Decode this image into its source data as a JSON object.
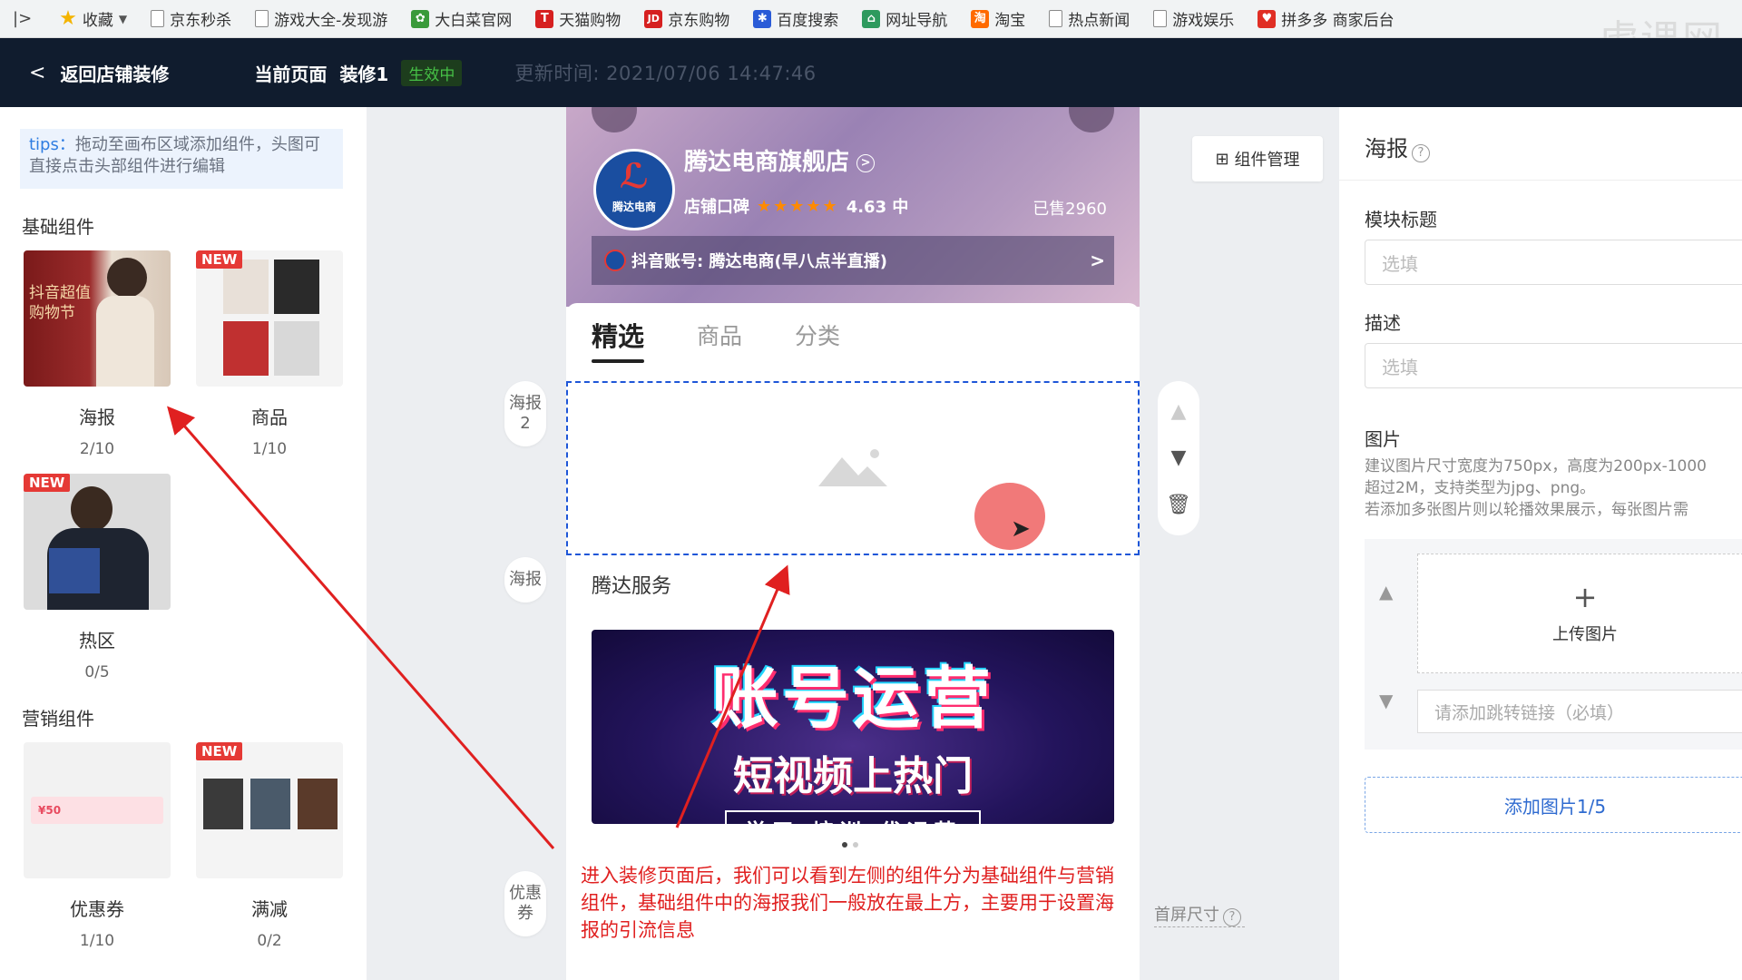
{
  "bookmarks": {
    "items": [
      {
        "label": "收藏",
        "icon": "star-icon"
      },
      {
        "label": "京东秒杀",
        "icon": "page-icon"
      },
      {
        "label": "游戏大全-发现游",
        "icon": "page-icon"
      },
      {
        "label": "大白菜官网",
        "icon": "cabbage-icon"
      },
      {
        "label": "天猫购物",
        "icon": "tmall-icon"
      },
      {
        "label": "京东购物",
        "icon": "jd-icon"
      },
      {
        "label": "百度搜索",
        "icon": "baidu-icon"
      },
      {
        "label": "网址导航",
        "icon": "nav-icon"
      },
      {
        "label": "淘宝",
        "icon": "taobao-icon"
      },
      {
        "label": "热点新闻",
        "icon": "page-icon"
      },
      {
        "label": "游戏娱乐",
        "icon": "page-icon"
      },
      {
        "label": "拼多多 商家后台",
        "icon": "pdd-icon"
      }
    ],
    "watermark": "虎课网"
  },
  "header": {
    "back_label": "返回店铺装修",
    "current_page_label": "当前页面",
    "page_name": "装修1",
    "status": "生效中",
    "updated": "更新时间: 2021/07/06 14:47:46"
  },
  "left": {
    "tips_key": "tips：",
    "tips_text": "拖动至画布区域添加组件，头图可直接点击头部组件进行编辑",
    "basic_title": "基础组件",
    "marketing_title": "营销组件",
    "new_tag": "NEW",
    "poster_thumb_text": "抖音超值购物节",
    "coupon_thumb_text": "¥50",
    "components": [
      {
        "name": "海报",
        "count": "2/10"
      },
      {
        "name": "商品",
        "count": "1/10"
      },
      {
        "name": "热区",
        "count": "0/5"
      },
      {
        "name": "优惠券",
        "count": "1/10"
      },
      {
        "name": "满减",
        "count": "0/2"
      }
    ]
  },
  "canvas": {
    "shop_name": "腾达电商旗舰店",
    "logo_text": "腾达电商",
    "rating_label": "店铺口碑",
    "stars": "★★★★★",
    "rating_value": "4.63 中",
    "sold": "已售2960",
    "account": "抖音账号: 腾达电商(早八点半直播)",
    "tabs": [
      "精选",
      "商品",
      "分类"
    ],
    "service_title": "腾达服务",
    "banner": {
      "line1": "账号运营",
      "line2": "短视频上热门",
      "line3": "学习 培训 代运营"
    },
    "caption": "进入装修页面后，我们可以看到左侧的组件分为基础组件与营销组件，基础组件中的海报我们一般放在最上方，主要用于设置海报的引流信息",
    "side_tags": [
      "海报2",
      "海报",
      "优惠券"
    ],
    "manage_label": "组件管理",
    "first_screen": "首屏尺寸"
  },
  "right": {
    "title": "海报",
    "module_title_label": "模块标题",
    "module_title_placeholder": "选填",
    "desc_label": "描述",
    "desc_placeholder": "选填",
    "image_label": "图片",
    "hint_lines": [
      "建议图片尺寸宽度为750px，高度为200px-1000",
      "超过2M，支持类型为jpg、png。",
      "若添加多张图片则以轮播效果展示，每张图片需"
    ],
    "upload_label": "上传图片",
    "link_placeholder": "请添加跳转链接（必填）",
    "add_image": "添加图片1/5"
  },
  "colors": {
    "header_bg": "#101c2e",
    "accent_blue": "#1e56d8",
    "active_green": "#46c046",
    "annotation_red": "#e02020"
  }
}
